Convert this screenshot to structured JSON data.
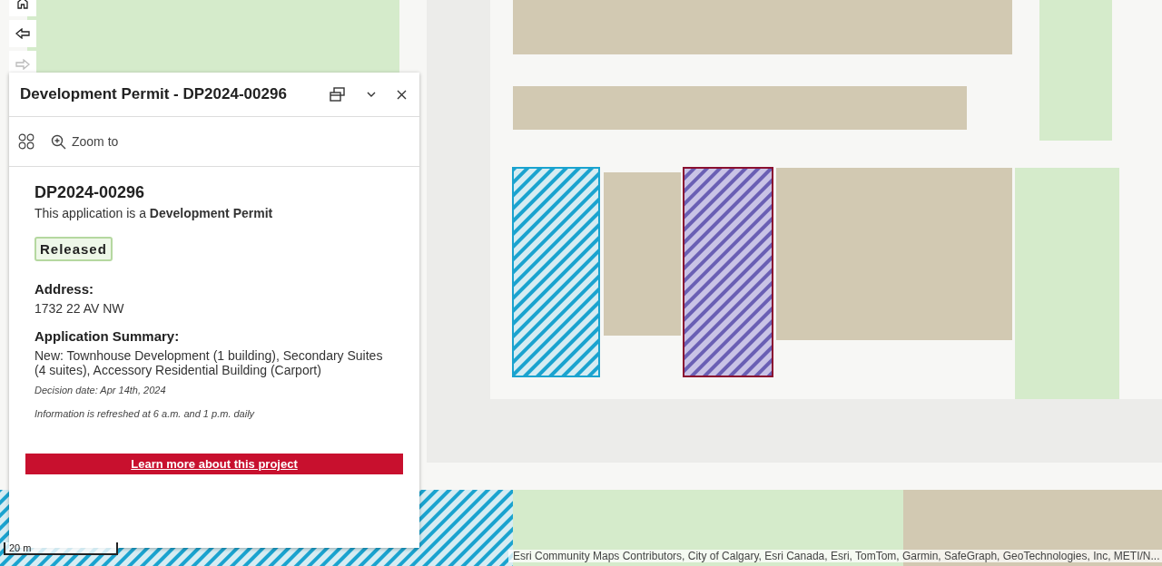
{
  "nav": {
    "buttons": [
      {
        "kind": "home",
        "disabled": false
      },
      {
        "kind": "back",
        "disabled": false
      },
      {
        "kind": "forward",
        "disabled": true
      }
    ]
  },
  "popup": {
    "title": "Development Permit - DP2024-00296",
    "action": "Zoom to",
    "heading": "DP2024-00296",
    "intro": "This application is a **Development Permit**",
    "status": "Released",
    "fields": [
      {
        "label": "Address:",
        "value": "1732 22 AV NW"
      },
      {
        "label": "Application Summary:",
        "value": "New: Townhouse Development (1 building), Secondary Suites (4 suites), Accessory Residential Building (Carport)"
      }
    ],
    "notes": [
      "Decision date: Apr 14th, 2024",
      "Information is refreshed at 6 a.m. and 1 p.m. daily"
    ],
    "link": "Learn more about this project"
  },
  "scale_bar": {
    "metric": "20 m"
  },
  "attribution": "Esri Community Maps Contributors, City of Calgary, Esri Canada, Esri, TomTom, Garmin, SafeGraph, GeoTechnologies, Inc, METI/N..."
}
